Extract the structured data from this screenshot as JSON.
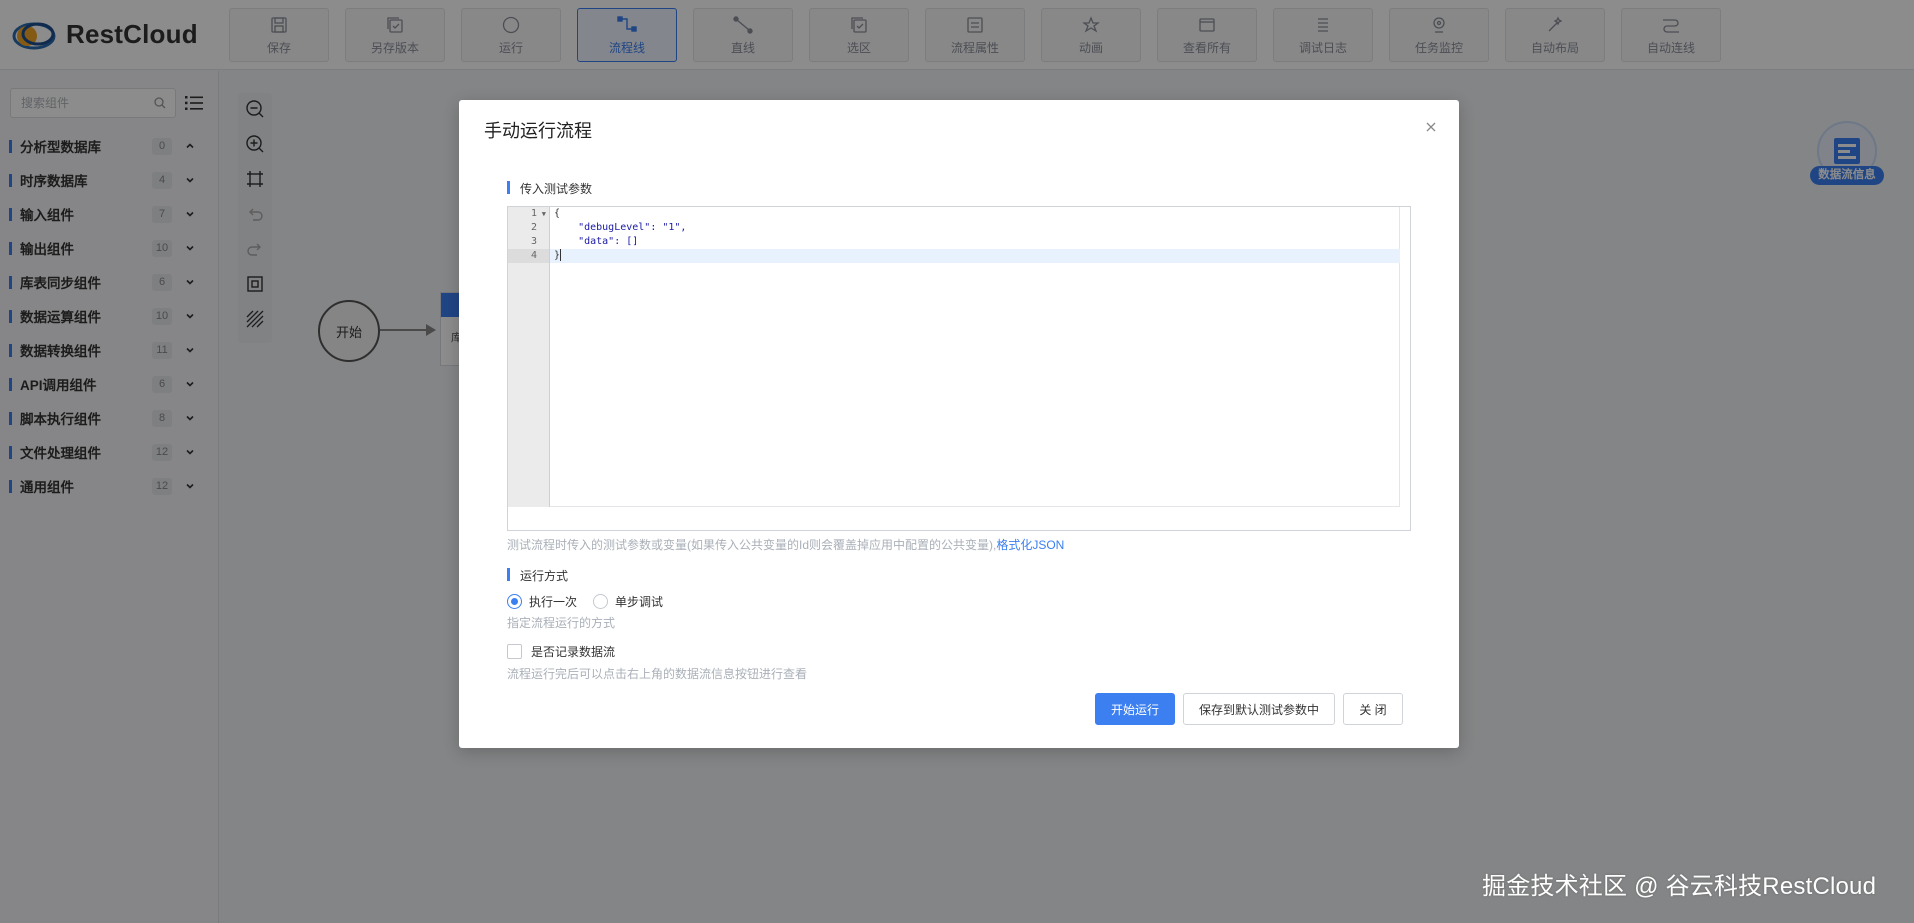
{
  "header": {
    "logo_text": "RestCloud",
    "toolbar": [
      {
        "label": "保存",
        "icon": "save-icon"
      },
      {
        "label": "另存版本",
        "icon": "save-version-icon"
      },
      {
        "label": "运行",
        "icon": "run-icon"
      },
      {
        "label": "流程线",
        "icon": "flow-line-icon",
        "active": true
      },
      {
        "label": "直线",
        "icon": "straight-line-icon"
      },
      {
        "label": "选区",
        "icon": "selection-icon"
      },
      {
        "label": "流程属性",
        "icon": "flow-properties-icon"
      },
      {
        "label": "动画",
        "icon": "animation-icon"
      },
      {
        "label": "查看所有",
        "icon": "view-all-icon"
      },
      {
        "label": "调试日志",
        "icon": "debug-log-icon"
      },
      {
        "label": "任务监控",
        "icon": "task-monitor-icon"
      },
      {
        "label": "自动布局",
        "icon": "auto-layout-icon"
      },
      {
        "label": "自动连线",
        "icon": "auto-connect-icon"
      }
    ]
  },
  "sidebar": {
    "search_placeholder": "搜索组件",
    "categories": [
      {
        "name": "分析型数据库",
        "count": "0",
        "expanded": true
      },
      {
        "name": "时序数据库",
        "count": "4"
      },
      {
        "name": "输入组件",
        "count": "7"
      },
      {
        "name": "输出组件",
        "count": "10"
      },
      {
        "name": "库表同步组件",
        "count": "6"
      },
      {
        "name": "数据运算组件",
        "count": "10"
      },
      {
        "name": "数据转换组件",
        "count": "11"
      },
      {
        "name": "API调用组件",
        "count": "6"
      },
      {
        "name": "脚本执行组件",
        "count": "8"
      },
      {
        "name": "文件处理组件",
        "count": "12"
      },
      {
        "name": "通用组件",
        "count": "12"
      }
    ]
  },
  "canvas": {
    "start_node_label": "开始",
    "next_node_label": "库",
    "float_info_label": "数据流信息"
  },
  "modal": {
    "title": "手动运行流程",
    "params_label": "传入测试参数",
    "code_lines": [
      "{",
      "    \"debugLevel\": \"1\",",
      "    \"data\": []",
      "}"
    ],
    "line_numbers": [
      "1",
      "2",
      "3",
      "4"
    ],
    "params_help": "测试流程时传入的测试参数或变量(如果传入公共变量的Id则会覆盖掉应用中配置的公共变量),",
    "format_json_link": "格式化JSON",
    "run_mode_label": "运行方式",
    "run_once": "执行一次",
    "step_debug": "单步调试",
    "run_mode_help": "指定流程运行的方式",
    "record_flow_label": "是否记录数据流",
    "record_flow_help": "流程运行完后可以点击右上角的数据流信息按钮进行查看",
    "start_button": "开始运行",
    "save_default_button": "保存到默认测试参数中",
    "close_button": "关 闭"
  },
  "watermark": "掘金技术社区 @ 谷云科技RestCloud",
  "colors": {
    "accent": "#3b7ff0"
  }
}
